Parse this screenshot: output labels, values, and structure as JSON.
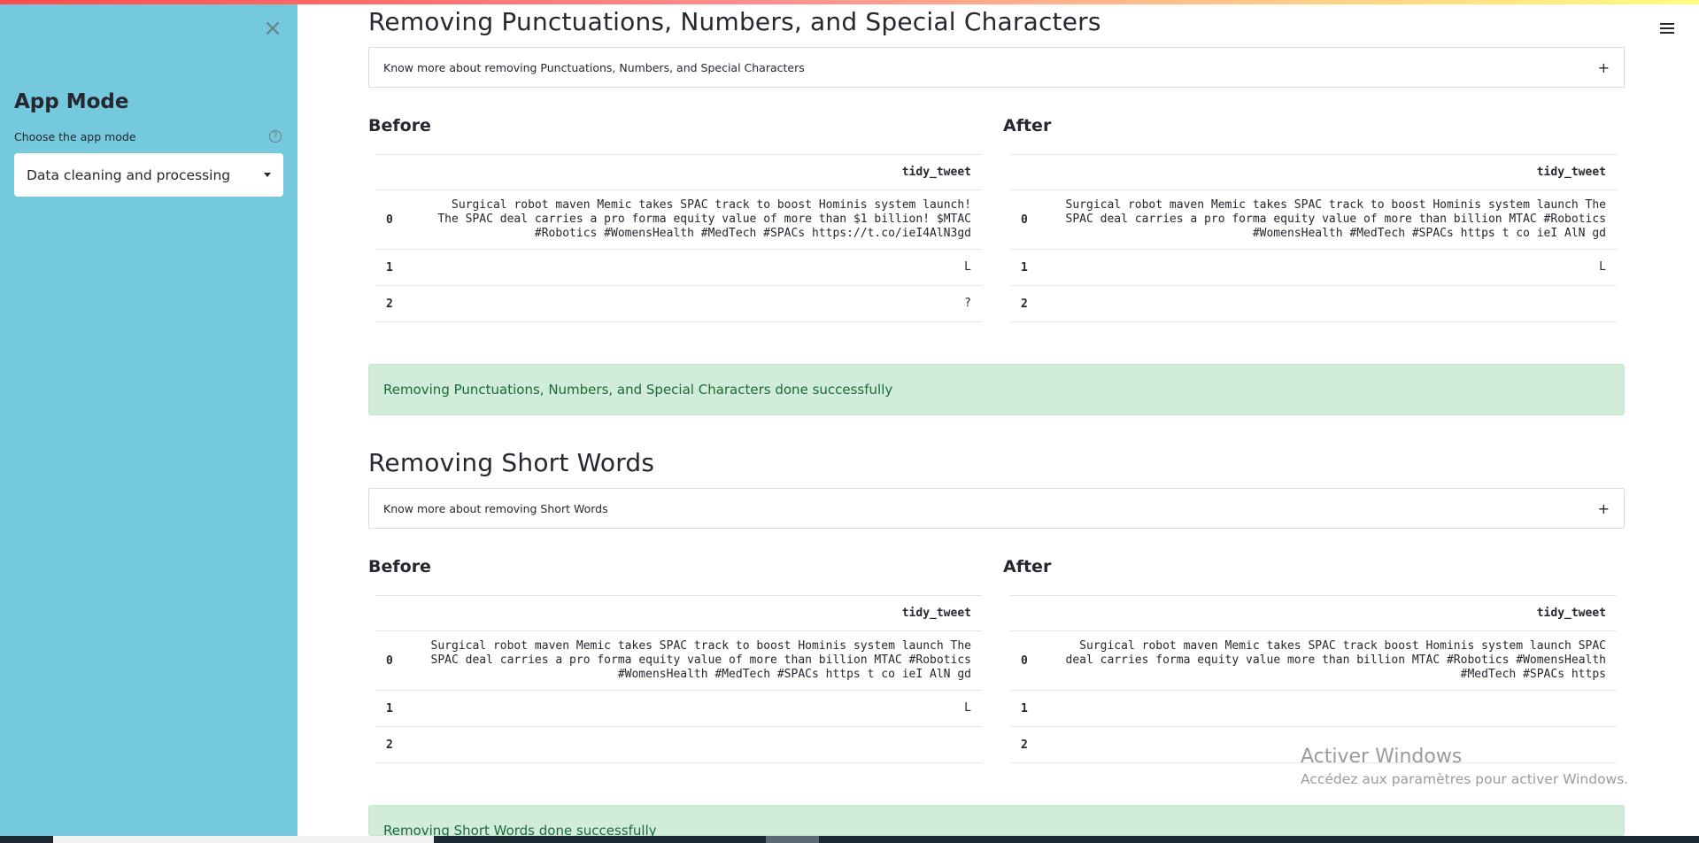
{
  "sidebar": {
    "title": "App Mode",
    "select_label": "Choose the app mode",
    "help_icon": "?",
    "selected_mode": "Data cleaning and processing",
    "close_icon": "×"
  },
  "sections": [
    {
      "title": "Removing Punctuations, Numbers, and Special Characters",
      "expander_label": "Know more about removing Punctuations, Numbers, and Special Characters",
      "expander_icon": "+",
      "before_label": "Before",
      "after_label": "After",
      "column": "tidy_tweet",
      "before_rows": [
        {
          "idx": "0",
          "text": "Surgical robot maven Memic takes SPAC track to boost Hominis system launch!\nThe SPAC deal carries a pro forma equity value of more than $1 billion! $MTAC\n#Robotics #WomensHealth #MedTech #SPACs https://t.co/ieI4AlN3gd"
        },
        {
          "idx": "1",
          "text": "L"
        },
        {
          "idx": "2",
          "text": "?"
        }
      ],
      "after_rows": [
        {
          "idx": "0",
          "text": "Surgical robot maven Memic takes SPAC track to boost Hominis system launch The\nSPAC deal carries a pro forma equity value of more than billion MTAC #Robotics\n#WomensHealth #MedTech #SPACs https t co ieI AlN gd"
        },
        {
          "idx": "1",
          "text": "L"
        },
        {
          "idx": "2",
          "text": ""
        }
      ],
      "success": "Removing Punctuations, Numbers, and Special Characters done successfully"
    },
    {
      "title": "Removing Short Words",
      "expander_label": "Know more about removing Short Words",
      "expander_icon": "+",
      "before_label": "Before",
      "after_label": "After",
      "column": "tidy_tweet",
      "before_rows": [
        {
          "idx": "0",
          "text": "Surgical robot maven Memic takes SPAC track to boost Hominis system launch The\nSPAC deal carries a pro forma equity value of more than billion MTAC #Robotics\n#WomensHealth #MedTech #SPACs https t co ieI AlN gd"
        },
        {
          "idx": "1",
          "text": "L"
        },
        {
          "idx": "2",
          "text": ""
        }
      ],
      "after_rows": [
        {
          "idx": "0",
          "text": "Surgical robot maven Memic takes SPAC track boost Hominis system launch SPAC\ndeal carries forma equity value more than billion MTAC #Robotics #WomensHealth\n#MedTech #SPACs https"
        },
        {
          "idx": "1",
          "text": ""
        },
        {
          "idx": "2",
          "text": ""
        }
      ],
      "success": "Removing Short Words done successfully"
    }
  ],
  "watermark": {
    "title": "Activer Windows",
    "subtitle": "Accédez aux paramètres pour activer Windows."
  },
  "colors": {
    "sidebar_bg": "#74c9dc",
    "success_bg": "#d1ecd8",
    "success_text": "#1b6b3a"
  }
}
